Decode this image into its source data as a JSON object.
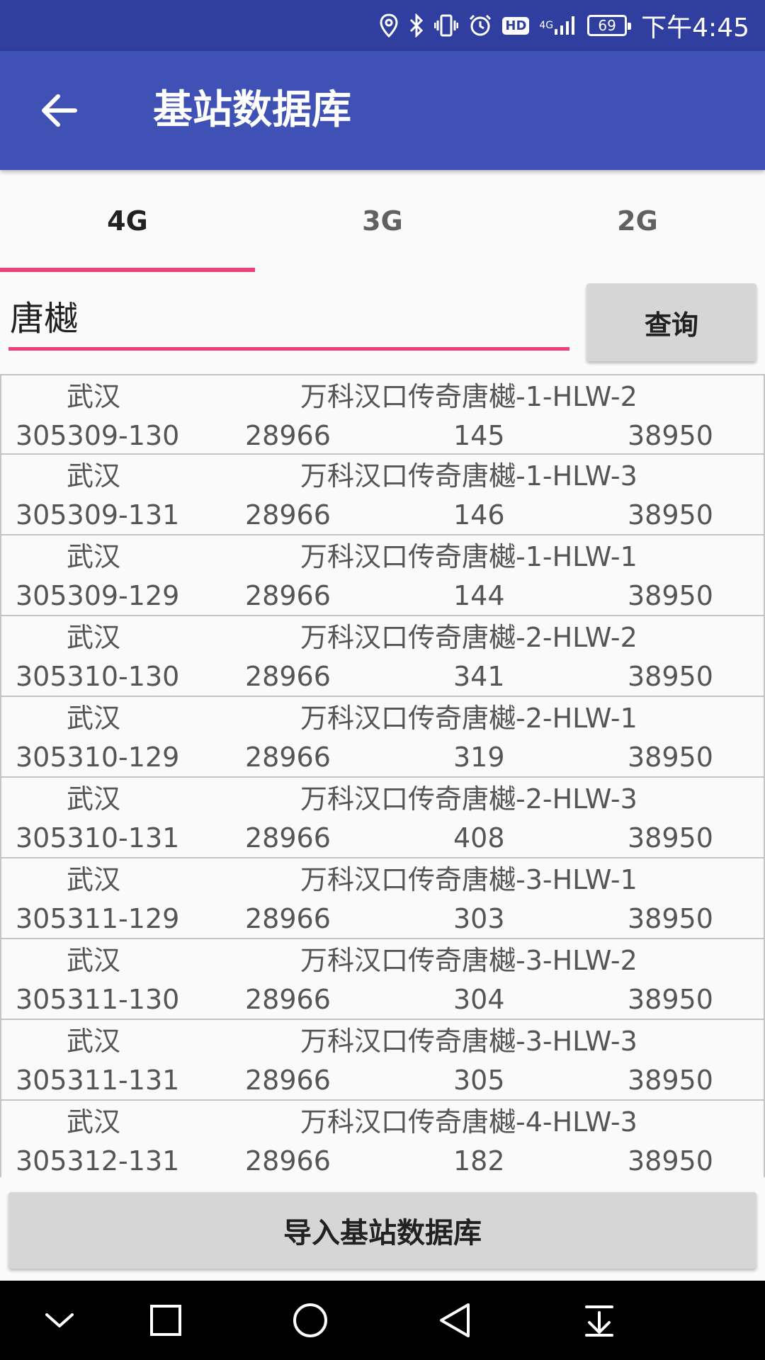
{
  "status_bar": {
    "time": "下午4:45",
    "battery": "69",
    "hd": "HD",
    "network": "4G"
  },
  "app_bar": {
    "title": "基站数据库"
  },
  "tabs": [
    {
      "label": "4G",
      "active": true
    },
    {
      "label": "3G",
      "active": false
    },
    {
      "label": "2G",
      "active": false
    }
  ],
  "search": {
    "value": "唐樾",
    "button_label": "查询"
  },
  "records": [
    {
      "city": "武汉",
      "name": "万科汉口传奇唐樾-1-HLW-2",
      "id": "305309-130",
      "tac": "28966",
      "pci": "145",
      "earfcn": "38950"
    },
    {
      "city": "武汉",
      "name": "万科汉口传奇唐樾-1-HLW-3",
      "id": "305309-131",
      "tac": "28966",
      "pci": "146",
      "earfcn": "38950"
    },
    {
      "city": "武汉",
      "name": "万科汉口传奇唐樾-1-HLW-1",
      "id": "305309-129",
      "tac": "28966",
      "pci": "144",
      "earfcn": "38950"
    },
    {
      "city": "武汉",
      "name": "万科汉口传奇唐樾-2-HLW-2",
      "id": "305310-130",
      "tac": "28966",
      "pci": "341",
      "earfcn": "38950"
    },
    {
      "city": "武汉",
      "name": "万科汉口传奇唐樾-2-HLW-1",
      "id": "305310-129",
      "tac": "28966",
      "pci": "319",
      "earfcn": "38950"
    },
    {
      "city": "武汉",
      "name": "万科汉口传奇唐樾-2-HLW-3",
      "id": "305310-131",
      "tac": "28966",
      "pci": "408",
      "earfcn": "38950"
    },
    {
      "city": "武汉",
      "name": "万科汉口传奇唐樾-3-HLW-1",
      "id": "305311-129",
      "tac": "28966",
      "pci": "303",
      "earfcn": "38950"
    },
    {
      "city": "武汉",
      "name": "万科汉口传奇唐樾-3-HLW-2",
      "id": "305311-130",
      "tac": "28966",
      "pci": "304",
      "earfcn": "38950"
    },
    {
      "city": "武汉",
      "name": "万科汉口传奇唐樾-3-HLW-3",
      "id": "305311-131",
      "tac": "28966",
      "pci": "305",
      "earfcn": "38950"
    },
    {
      "city": "武汉",
      "name": "万科汉口传奇唐樾-4-HLW-3",
      "id": "305312-131",
      "tac": "28966",
      "pci": "182",
      "earfcn": "38950"
    }
  ],
  "import_button": {
    "label": "导入基站数据库"
  },
  "colors": {
    "status_bar": "#303f9f",
    "app_bar": "#3f51b5",
    "accent": "#ec407a",
    "button": "#d6d6d6"
  },
  "icons": {
    "back": "arrow-left-icon",
    "status": [
      "location-icon",
      "bluetooth-icon",
      "vibrate-icon",
      "alarm-icon",
      "hd-icon",
      "signal-icon",
      "battery-icon"
    ],
    "nav": [
      "chevron-down-icon",
      "recent-apps-icon",
      "home-icon",
      "back-triangle-icon",
      "notification-pull-icon"
    ]
  }
}
